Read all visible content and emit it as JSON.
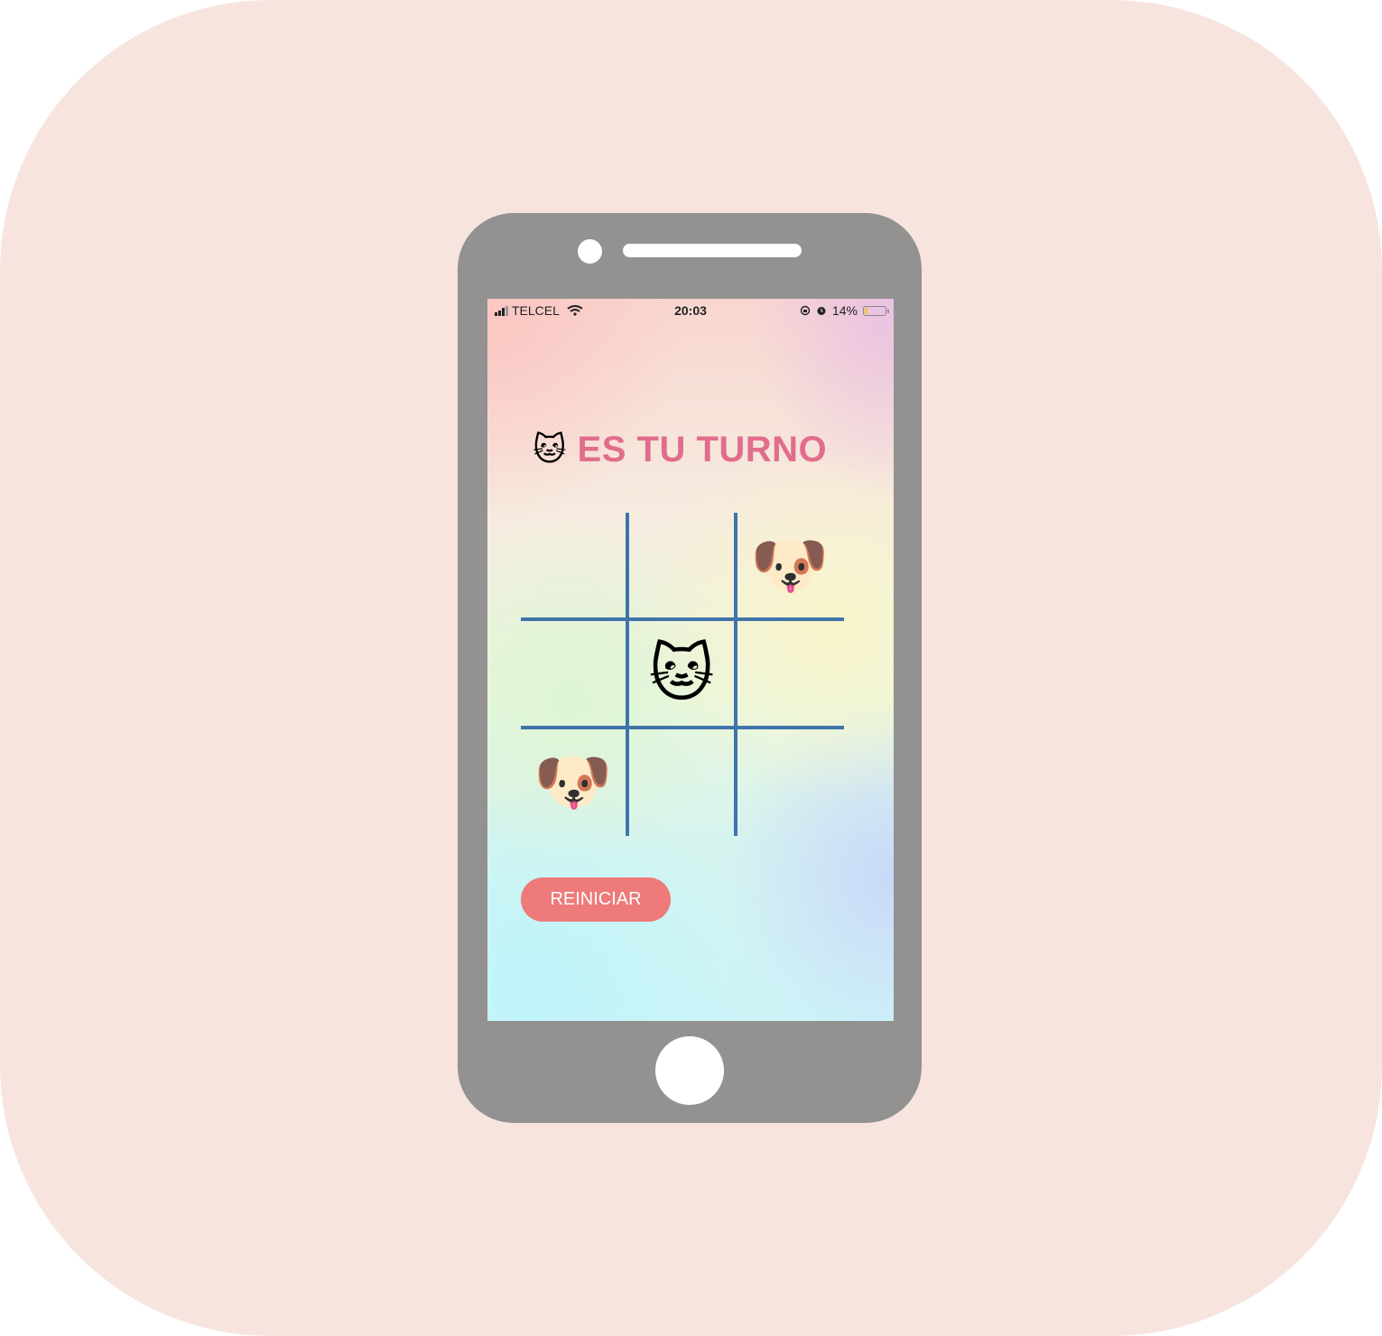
{
  "status_bar": {
    "carrier": "TELCEL",
    "time": "20:03",
    "battery": "14%",
    "battery_level": 0.14,
    "icons": [
      "signal-icon",
      "wifi-icon",
      "rotation-lock-icon",
      "alarm-icon",
      "battery-icon"
    ]
  },
  "game": {
    "turn_emoji": "🐱",
    "turn_text": "ES TU TURNO",
    "cells": [
      "",
      "",
      "🐶",
      "",
      "🐱",
      "",
      "🐶",
      "",
      ""
    ],
    "restart_label": "REINICIAR"
  },
  "colors": {
    "background_tile": "#f7e4df",
    "phone_body": "#939291",
    "title": "#e16d8d",
    "grid_lines": "#3f74ab",
    "restart_button": "#ef7a7a"
  }
}
